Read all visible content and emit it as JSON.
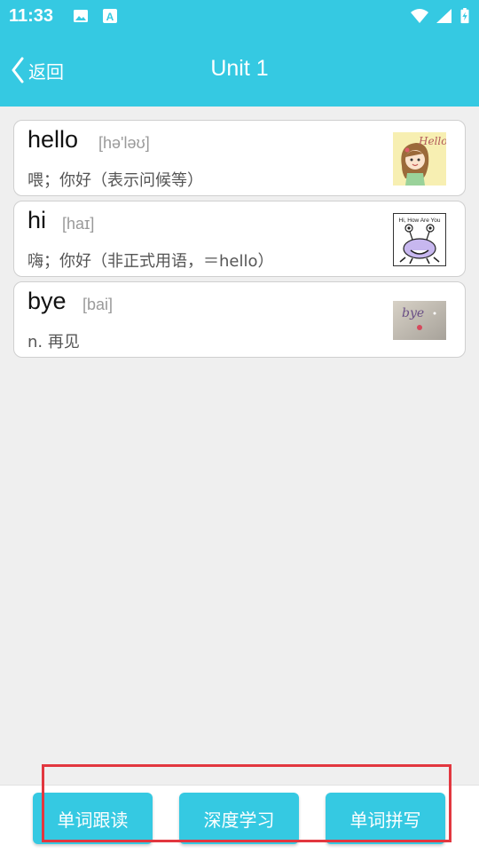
{
  "status": {
    "time": "11:33"
  },
  "header": {
    "back_label": "返回",
    "title": "Unit 1"
  },
  "words": [
    {
      "word": "hello",
      "phonetic": "[hə'ləʊ]",
      "meaning": "喂；你好（表示问候等）",
      "image": "hello-girl-image"
    },
    {
      "word": "hi",
      "phonetic": "[haɪ]",
      "meaning": "嗨；你好（非正式用语，＝hello）",
      "image": "hi-how-are-you-image"
    },
    {
      "word": "bye",
      "phonetic": "[bai]",
      "meaning": "n. 再见",
      "image": "bye-handwriting-image"
    }
  ],
  "image_text": {
    "hello": "Hello",
    "hi": "Hi, How Are You",
    "bye": "bye"
  },
  "actions": {
    "follow_read": "单词跟读",
    "deep_study": "深度学习",
    "spelling": "单词拼写"
  },
  "colors": {
    "accent": "#35c9e2",
    "highlight": "#e2373f",
    "background": "#efefef"
  }
}
